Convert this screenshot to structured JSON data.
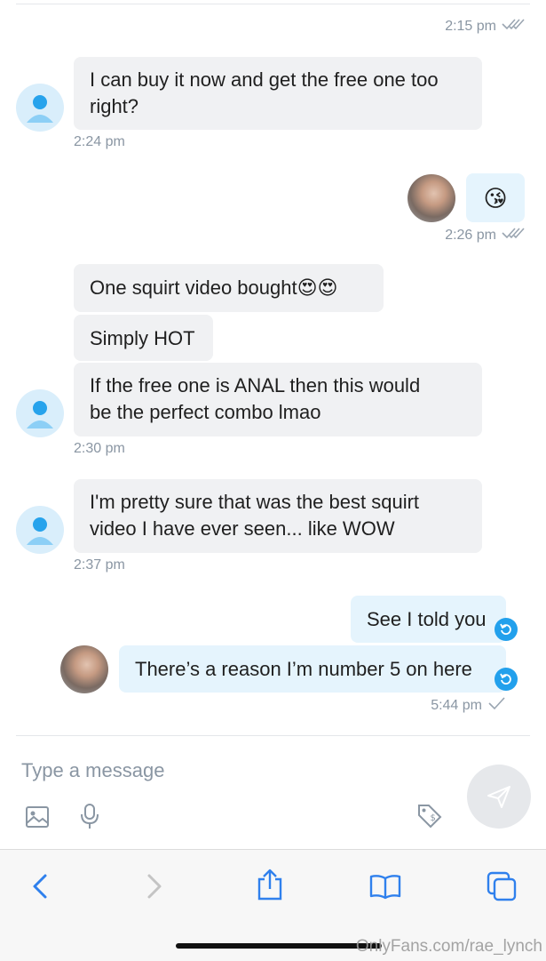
{
  "chat": {
    "t1": "2:15 pm",
    "msg1": "I can buy it now and get the free one too\nright?",
    "t2": "2:24 pm",
    "emoji": "😘",
    "t3": "2:26 pm",
    "msg2": "One squirt video bought😍😍",
    "msg3": "Simply HOT",
    "msg4": "If the free one is ANAL then this would\nbe the perfect combo lmao",
    "t4": "2:30 pm",
    "msg5": "I'm pretty sure that was the best squirt\nvideo I have ever seen... like WOW",
    "t5": "2:37 pm",
    "msg6": "See I told you",
    "msg7": "There’s a reason I’m number 5 on here",
    "t6": "5:44 pm"
  },
  "composer": {
    "placeholder": "Type a message"
  },
  "watermark": "OnlyFans.com/rae_lynch",
  "colors": {
    "accent": "#22a0ec",
    "incoming_bubble": "#f0f1f3",
    "outgoing_bubble": "#e5f4fd",
    "meta_text": "#8a96a3"
  },
  "icons": {
    "read_receipt": "double-check-icon",
    "sent_receipt": "check-icon",
    "retry": "retry-icon",
    "send": "paper-plane-icon",
    "image": "image-icon",
    "microphone": "microphone-icon",
    "price_tag": "price-tag-icon"
  }
}
